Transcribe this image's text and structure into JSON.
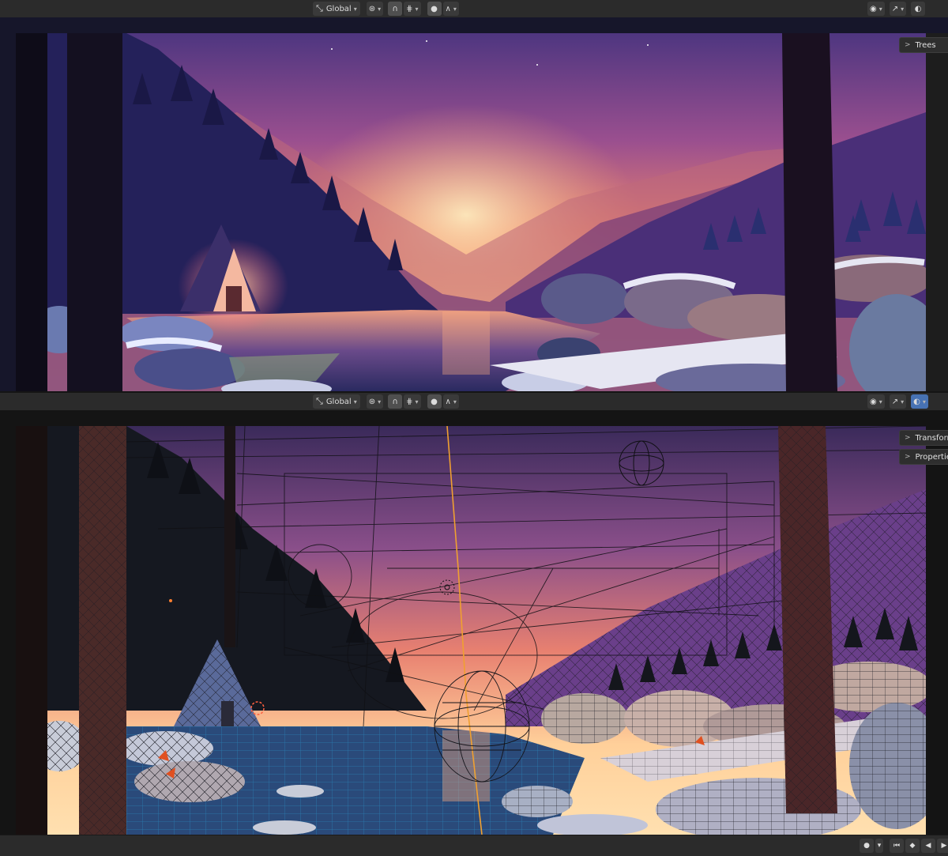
{
  "top_viewport": {
    "header": {
      "transform_orientation": "Global",
      "pivot_label": "",
      "snap_label": ""
    },
    "sidebar_tabs": [
      {
        "label": "Trees"
      }
    ],
    "shading_mode": "rendered"
  },
  "bottom_viewport": {
    "header": {
      "transform_orientation": "Global"
    },
    "sidebar_tabs": [
      {
        "label": "Transform"
      },
      {
        "label": "Properties"
      }
    ],
    "shading_mode": "rendered-with-overlays-wireframe"
  },
  "icons": {
    "transform_orientation": "axis-orientation-icon",
    "pivot": "pivot-point-icon",
    "snap": "snap-magnet-icon",
    "snap_target": "snap-increment-icon",
    "proportional": "proportional-edit-icon",
    "falloff": "falloff-curve-icon",
    "visibility": "eye-visibility-icon",
    "gizmo": "gizmo-icon",
    "overlay": "overlay-icon"
  },
  "timeline": {
    "buttons": [
      "record-icon",
      "jump-start-icon",
      "prev-keyframe-icon",
      "play-reverse-icon",
      "play-icon"
    ]
  },
  "colors": {
    "header_bg": "#2b2b2b",
    "accent_blue": "#4772b3",
    "sky_top": "#5a3a8c",
    "sky_glow": "#ffb070",
    "selection_orange": "#f0a030"
  }
}
